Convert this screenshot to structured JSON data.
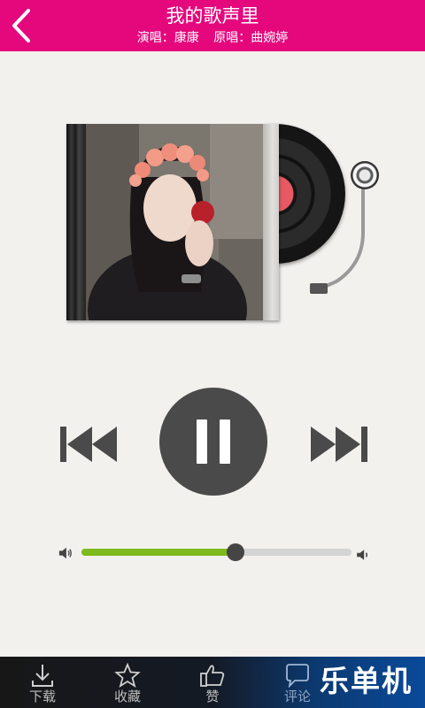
{
  "header": {
    "title": "我的歌声里",
    "singer_label": "演唱：康康",
    "original_label": "原唱：曲婉婷"
  },
  "player": {
    "progress": 0.57,
    "album_art": "woman with flower crown holding red apple"
  },
  "bottom_bar": {
    "tabs": [
      {
        "label": "下载",
        "icon": "download-icon"
      },
      {
        "label": "收藏",
        "icon": "star-icon"
      },
      {
        "label": "赞",
        "icon": "thumbs-up-icon"
      },
      {
        "label": "评论",
        "icon": "comment-icon"
      }
    ]
  },
  "brand": "乐单机",
  "colors": {
    "header_bg": "#e5087d",
    "progress_fill": "#7dba1d",
    "control_gray": "#4a4a4a"
  }
}
